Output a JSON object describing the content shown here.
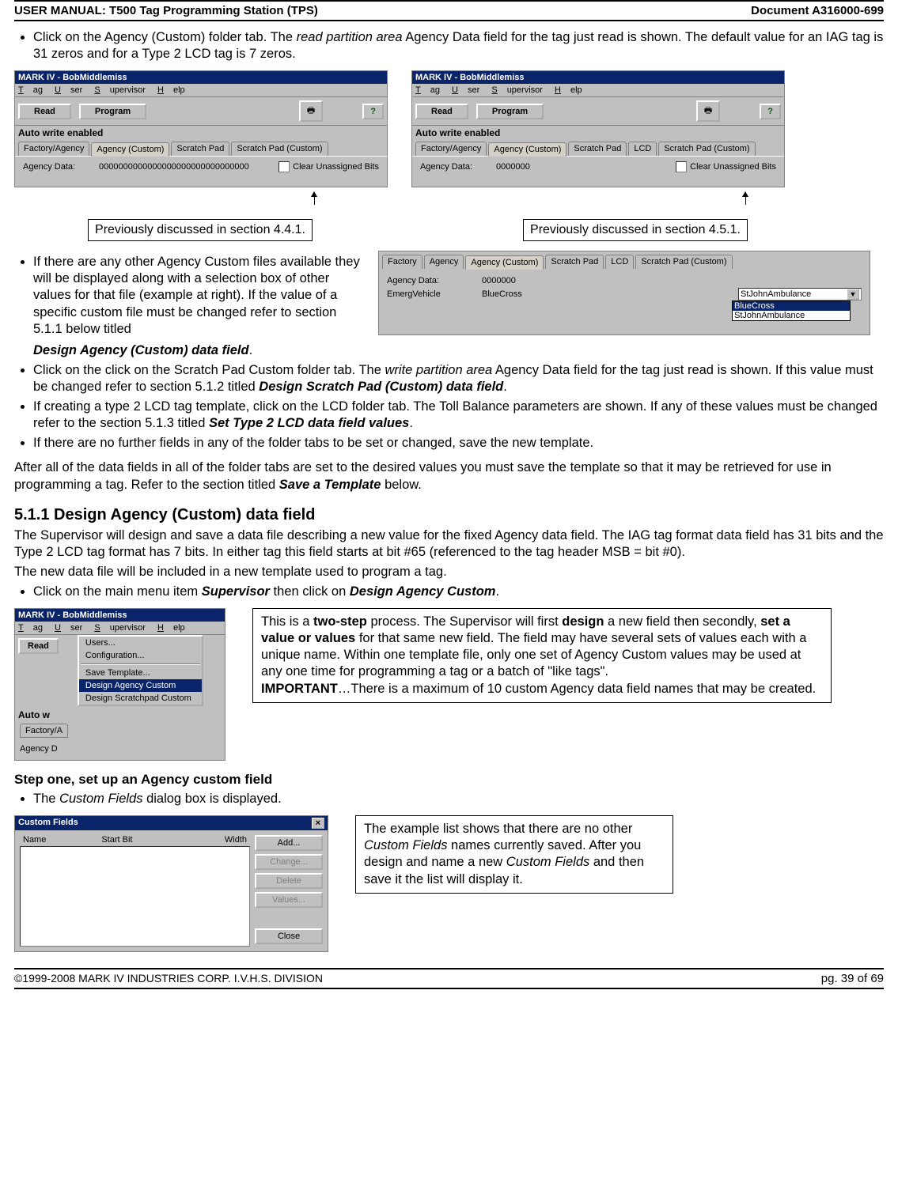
{
  "header": {
    "left": "USER MANUAL: T500 Tag Programming Station (TPS)",
    "right": "Document A316000-699"
  },
  "footer": {
    "left": "©1999-2008 MARK IV INDUSTRIES CORP. I.V.H.S. DIVISION",
    "right": "pg. 39 of 69"
  },
  "bullets": {
    "b1_a": "Click on the Agency (Custom) folder tab. The ",
    "b1_b": "read partition area",
    "b1_c": " Agency Data field for the tag just read is shown. The default value for an IAG tag is 31 zeros and for a Type 2 LCD tag is 7 zeros.",
    "b2_a": "If there are any other Agency Custom files available they will be displayed along with a selection box of other values for that file (example at right). If the value of a specific custom file must be changed refer to section 5.1.1 below titled ",
    "b2_b": "Design Agency (Custom) data field",
    "b2_c": ".",
    "b3_a": "Click on the click on the Scratch Pad Custom folder tab. The ",
    "b3_b": "write partition area",
    "b3_c": " Agency Data field for the tag just read is shown. If this value must be changed refer to section 5.1.2 titled ",
    "b3_d": "Design Scratch Pad (Custom) data field",
    "b3_e": ".",
    "b4_a": "If creating a type 2 LCD tag template, click on the LCD folder tab. The Toll Balance parameters are shown. If any of these values must be changed refer to the section 5.1.3 titled ",
    "b4_b": "Set Type 2 LCD data field values",
    "b4_c": ".",
    "b5": "If there are no further fields in any of the folder tabs to be set or changed, save the new template.",
    "b6_a": "Click on the main menu item ",
    "b6_b": "Supervisor",
    "b6_c": " then click on ",
    "b6_d": "Design Agency Custom",
    "b6_e": ".",
    "b7_a": "The ",
    "b7_b": "Custom Fields",
    "b7_c": " dialog box is displayed."
  },
  "paras": {
    "after_b5_a": "After all of the data fields in all of the folder tabs are set to the desired values you must save the template so that it may be retrieved for use in programming a tag. Refer to the section titled ",
    "after_b5_b": "Save a Template",
    "after_b5_c": " below.",
    "sec511_1": "The Supervisor will design and save a data file describing a new value for the fixed Agency data field. The IAG tag format data field has 31 bits and the Type 2 LCD tag format has 7 bits. In either tag this field starts at bit #65 (referenced to the tag header MSB = bit #0).",
    "sec511_2": "The new data file will be included in a new template used to program a tag."
  },
  "headings": {
    "sec511": "5.1.1 Design Agency (Custom) data field",
    "step1": "Step one, set up an Agency custom field"
  },
  "callouts": {
    "left": "Previously discussed in section 4.4.1.",
    "right": "Previously discussed in section 4.5.1."
  },
  "info_box": {
    "a": "This is a ",
    "b": "two-step",
    "c": " process. The Supervisor will first ",
    "d": "design",
    "e": " a new field then secondly, ",
    "f": "set a value or values",
    "g": " for that same new field. The field may have several sets of values each with a unique name. Within one template file, only one set of Agency Custom values may be used at any one time for programming a tag or a batch of \"like tags\".",
    "h": "IMPORTANT",
    "i": "…There is a maximum of 10 custom Agency data field names that may be created."
  },
  "cf_info": {
    "a": "The example list shows that there are no other ",
    "b": "Custom Fields",
    "c": " names currently saved. After you design and name a new ",
    "d": "Custom Fields",
    "e": " and then save it the list will display it."
  },
  "app": {
    "title": "MARK IV - BobMiddlemiss",
    "menu": {
      "tag": "Tag",
      "user": "User",
      "supervisor": "Supervisor",
      "help": "Help"
    },
    "toolbar": {
      "read": "Read",
      "program": "Program",
      "print": "🖶",
      "helpicon": "?"
    },
    "section": "Auto write enabled",
    "tabs": {
      "fa": "Factory/Agency",
      "agc": "Agency (Custom)",
      "sp": "Scratch Pad",
      "lcd": "LCD",
      "spc": "Scratch Pad (Custom)"
    },
    "labels": {
      "agency_data": "Agency Data:",
      "emerg": "EmergVehicle",
      "clear": "Clear Unassigned Bits"
    },
    "values": {
      "zeros31": "0000000000000000000000000000000",
      "zeros7": "0000000",
      "bluecross": "BlueCross"
    },
    "dropdown": {
      "current": "StJohnAmbulance",
      "opt_sel": "BlueCross",
      "opt2": "StJohnAmbulance"
    }
  },
  "sup_menu": {
    "users": "Users...",
    "config": "Configuration...",
    "save_tpl": "Save Template...",
    "design_agency": "Design Agency Custom",
    "design_scratch": "Design Scratchpad Custom"
  },
  "cf_dialog": {
    "title": "Custom Fields",
    "close_x": "×",
    "headers": {
      "name": "Name",
      "start": "Start Bit",
      "width": "Width"
    },
    "buttons": {
      "add": "Add...",
      "change": "Change...",
      "delete": "Delete",
      "values": "Values...",
      "close": "Close"
    }
  }
}
